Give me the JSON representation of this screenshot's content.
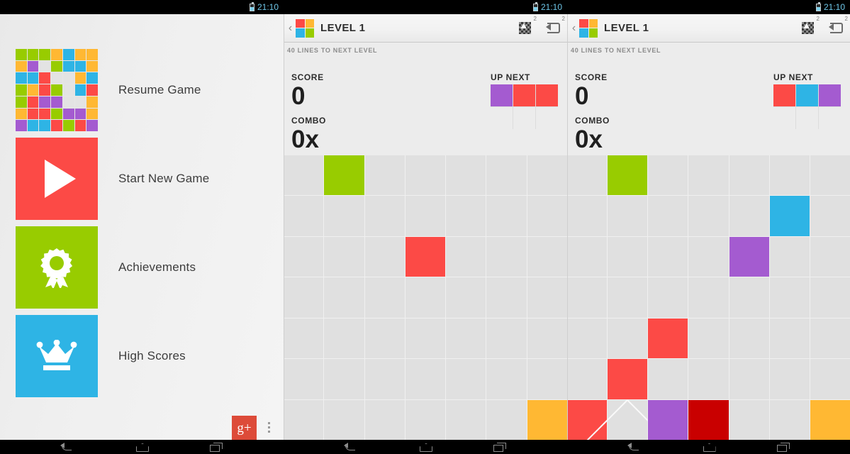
{
  "palette": {
    "red": "#fc4a46",
    "dark_red": "#c90000",
    "green": "#98cc00",
    "blue": "#2eb4e5",
    "purple": "#a45bd0",
    "orange": "#ffb833",
    "empty": "#e0e0e0",
    "board_gap": "#f0f0f0",
    "panel_bg": "#ececec",
    "gplus_red": "#dd4b39"
  },
  "statusbar": {
    "segments": [
      {
        "time": "21:10",
        "battery_icon": "battery-icon"
      },
      {
        "time": "21:10",
        "battery_icon": "battery-icon"
      },
      {
        "time": "21:10",
        "battery_icon": "battery-icon"
      }
    ]
  },
  "menu": {
    "items": [
      {
        "label": "Resume Game",
        "icon": "board-thumbnail-icon",
        "tile_color": "#e6e6e6"
      },
      {
        "label": "Start New Game",
        "icon": "play-icon",
        "tile_color": "#fc4a46"
      },
      {
        "label": "Achievements",
        "icon": "ribbon-award-icon",
        "tile_color": "#98cc00"
      },
      {
        "label": "High Scores",
        "icon": "crown-icon",
        "tile_color": "#2eb4e5"
      }
    ],
    "google_plus_label": "g+",
    "overflow_label": "overflow-menu"
  },
  "thumbnail_grid": [
    [
      "green",
      "green",
      "green",
      "orange",
      "blue",
      "orange",
      "orange"
    ],
    [
      "orange",
      "purple",
      "empty",
      "green",
      "blue",
      "blue",
      "orange"
    ],
    [
      "blue",
      "blue",
      "red",
      "empty",
      "empty",
      "orange",
      "blue"
    ],
    [
      "green",
      "orange",
      "red",
      "green",
      "empty",
      "blue",
      "red"
    ],
    [
      "green",
      "red",
      "purple",
      "purple",
      "empty",
      "empty",
      "orange"
    ],
    [
      "orange",
      "red",
      "red",
      "green",
      "purple",
      "purple",
      "orange"
    ],
    [
      "purple",
      "blue",
      "blue",
      "red",
      "green",
      "red",
      "purple"
    ]
  ],
  "panels": [
    {
      "id": "game-panel-1",
      "actionbar": {
        "back_label": "‹",
        "title": "LEVEL 1",
        "logo_icon": "app-logo-icon",
        "buttons": [
          {
            "icon": "screenshot-icon",
            "superscript": "2"
          },
          {
            "icon": "rotate-icon",
            "superscript": "2"
          }
        ]
      },
      "lines_label": "40 LINES TO NEXT LEVEL",
      "hud": {
        "score_label": "SCORE",
        "score_value": "0",
        "combo_label": "COMBO",
        "combo_value": "0x",
        "upnext_label": "UP NEXT"
      },
      "upnext": [
        [
          "purple",
          "red",
          "red"
        ],
        [
          "empty",
          "empty",
          "empty"
        ]
      ],
      "board": [
        [
          "empty",
          "green",
          "empty",
          "empty",
          "empty",
          "empty",
          "empty"
        ],
        [
          "empty",
          "empty",
          "empty",
          "empty",
          "empty",
          "empty",
          "empty"
        ],
        [
          "empty",
          "empty",
          "empty",
          "red",
          "empty",
          "empty",
          "empty"
        ],
        [
          "empty",
          "empty",
          "empty",
          "empty",
          "empty",
          "empty",
          "empty"
        ],
        [
          "empty",
          "empty",
          "empty",
          "empty",
          "empty",
          "empty",
          "empty"
        ],
        [
          "empty",
          "empty",
          "empty",
          "empty",
          "empty",
          "empty",
          "empty"
        ],
        [
          "empty",
          "empty",
          "empty",
          "empty",
          "empty",
          "empty",
          "orange"
        ]
      ]
    },
    {
      "id": "game-panel-2",
      "actionbar": {
        "back_label": "‹",
        "title": "LEVEL 1",
        "logo_icon": "app-logo-icon",
        "buttons": [
          {
            "icon": "screenshot-icon",
            "superscript": "2"
          },
          {
            "icon": "rotate-icon",
            "superscript": "2"
          }
        ]
      },
      "lines_label": "40 LINES TO NEXT LEVEL",
      "hud": {
        "score_label": "SCORE",
        "score_value": "0",
        "combo_label": "COMBO",
        "combo_value": "0x",
        "upnext_label": "UP NEXT"
      },
      "upnext": [
        [
          "red",
          "blue",
          "purple"
        ],
        [
          "empty",
          "empty",
          "empty"
        ]
      ],
      "board": [
        [
          "empty",
          "green",
          "empty",
          "empty",
          "empty",
          "empty",
          "empty"
        ],
        [
          "empty",
          "empty",
          "empty",
          "empty",
          "empty",
          "blue",
          "empty"
        ],
        [
          "empty",
          "empty",
          "empty",
          "empty",
          "purple",
          "empty",
          "empty"
        ],
        [
          "empty",
          "empty",
          "empty",
          "empty",
          "empty",
          "empty",
          "empty"
        ],
        [
          "empty",
          "empty",
          "red",
          "empty",
          "empty",
          "empty",
          "empty"
        ],
        [
          "empty",
          "red",
          "empty",
          "empty",
          "empty",
          "empty",
          "empty"
        ],
        [
          "red",
          "blocked",
          "purple",
          "dark_red",
          "empty",
          "empty",
          "orange"
        ]
      ]
    }
  ],
  "navbar": {
    "buttons": [
      {
        "icon": "back-icon"
      },
      {
        "icon": "home-icon"
      },
      {
        "icon": "recents-icon"
      }
    ]
  }
}
